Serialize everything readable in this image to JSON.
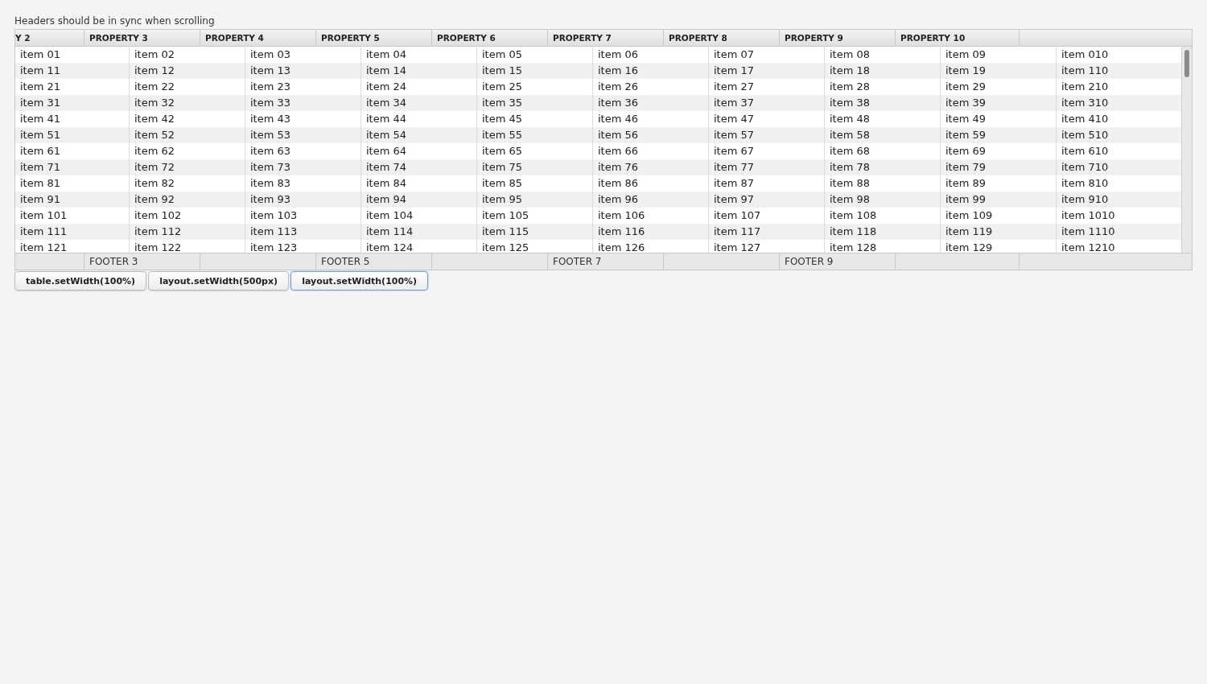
{
  "caption": "Headers should be in sync when scrolling",
  "table": {
    "columns": [
      "Y 2",
      "PROPERTY 3",
      "PROPERTY 4",
      "PROPERTY 5",
      "PROPERTY 6",
      "PROPERTY 7",
      "PROPERTY 8",
      "PROPERTY 9",
      "PROPERTY 10"
    ],
    "rows": [
      [
        "item 01",
        "item 02",
        "item 03",
        "item 04",
        "item 05",
        "item 06",
        "item 07",
        "item 08",
        "item 09",
        "item 010"
      ],
      [
        "item 11",
        "item 12",
        "item 13",
        "item 14",
        "item 15",
        "item 16",
        "item 17",
        "item 18",
        "item 19",
        "item 110"
      ],
      [
        "item 21",
        "item 22",
        "item 23",
        "item 24",
        "item 25",
        "item 26",
        "item 27",
        "item 28",
        "item 29",
        "item 210"
      ],
      [
        "item 31",
        "item 32",
        "item 33",
        "item 34",
        "item 35",
        "item 36",
        "item 37",
        "item 38",
        "item 39",
        "item 310"
      ],
      [
        "item 41",
        "item 42",
        "item 43",
        "item 44",
        "item 45",
        "item 46",
        "item 47",
        "item 48",
        "item 49",
        "item 410"
      ],
      [
        "item 51",
        "item 52",
        "item 53",
        "item 54",
        "item 55",
        "item 56",
        "item 57",
        "item 58",
        "item 59",
        "item 510"
      ],
      [
        "item 61",
        "item 62",
        "item 63",
        "item 64",
        "item 65",
        "item 66",
        "item 67",
        "item 68",
        "item 69",
        "item 610"
      ],
      [
        "item 71",
        "item 72",
        "item 73",
        "item 74",
        "item 75",
        "item 76",
        "item 77",
        "item 78",
        "item 79",
        "item 710"
      ],
      [
        "item 81",
        "item 82",
        "item 83",
        "item 84",
        "item 85",
        "item 86",
        "item 87",
        "item 88",
        "item 89",
        "item 810"
      ],
      [
        "item 91",
        "item 92",
        "item 93",
        "item 94",
        "item 95",
        "item 96",
        "item 97",
        "item 98",
        "item 99",
        "item 910"
      ],
      [
        "item 101",
        "item 102",
        "item 103",
        "item 104",
        "item 105",
        "item 106",
        "item 107",
        "item 108",
        "item 109",
        "item 1010"
      ],
      [
        "item 111",
        "item 112",
        "item 113",
        "item 114",
        "item 115",
        "item 116",
        "item 117",
        "item 118",
        "item 119",
        "item 1110"
      ],
      [
        "item 121",
        "item 122",
        "item 123",
        "item 124",
        "item 125",
        "item 126",
        "item 127",
        "item 128",
        "item 129",
        "item 1210"
      ]
    ],
    "footers": [
      "FOOTER 3",
      "FOOTER 5",
      "FOOTER 7",
      "FOOTER 9"
    ]
  },
  "buttons": [
    {
      "label": "table.setWidth(100%)",
      "focused": false
    },
    {
      "label": "layout.setWidth(500px)",
      "focused": false
    },
    {
      "label": "layout.setWidth(100%)",
      "focused": true
    }
  ]
}
